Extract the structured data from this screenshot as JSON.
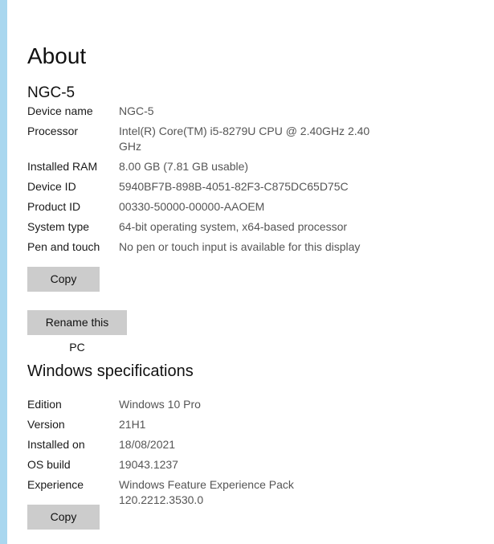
{
  "about": {
    "title": "About",
    "device_heading": "NGC-5",
    "device_specs": [
      {
        "label": "Device name",
        "value": "NGC-5"
      },
      {
        "label": "Processor",
        "value": "Intel(R) Core(TM) i5-8279U CPU @ 2.40GHz   2.40 GHz"
      },
      {
        "label": "Installed RAM",
        "value": "8.00 GB (7.81 GB usable)"
      },
      {
        "label": "Device ID",
        "value": "5940BF7B-898B-4051-82F3-C875DC65D75C"
      },
      {
        "label": "Product ID",
        "value": "00330-50000-00000-AAOEM"
      },
      {
        "label": "System type",
        "value": "64-bit operating system, x64-based processor"
      },
      {
        "label": "Pen and touch",
        "value": "No pen or touch input is available for this display"
      }
    ],
    "copy_label": "Copy",
    "rename_label": "Rename this PC"
  },
  "windows": {
    "heading": "Windows specifications",
    "specs": [
      {
        "label": "Edition",
        "value": "Windows 10 Pro"
      },
      {
        "label": "Version",
        "value": "21H1"
      },
      {
        "label": "Installed on",
        "value": "18/08/2021"
      },
      {
        "label": "OS build",
        "value": "19043.1237"
      },
      {
        "label": "Experience",
        "value": "Windows Feature Experience Pack 120.2212.3530.0"
      }
    ],
    "copy_label": "Copy"
  },
  "colors": {
    "side_strip": "#a9d7ef",
    "button_bg": "#cccccc",
    "value_text": "#555555"
  }
}
